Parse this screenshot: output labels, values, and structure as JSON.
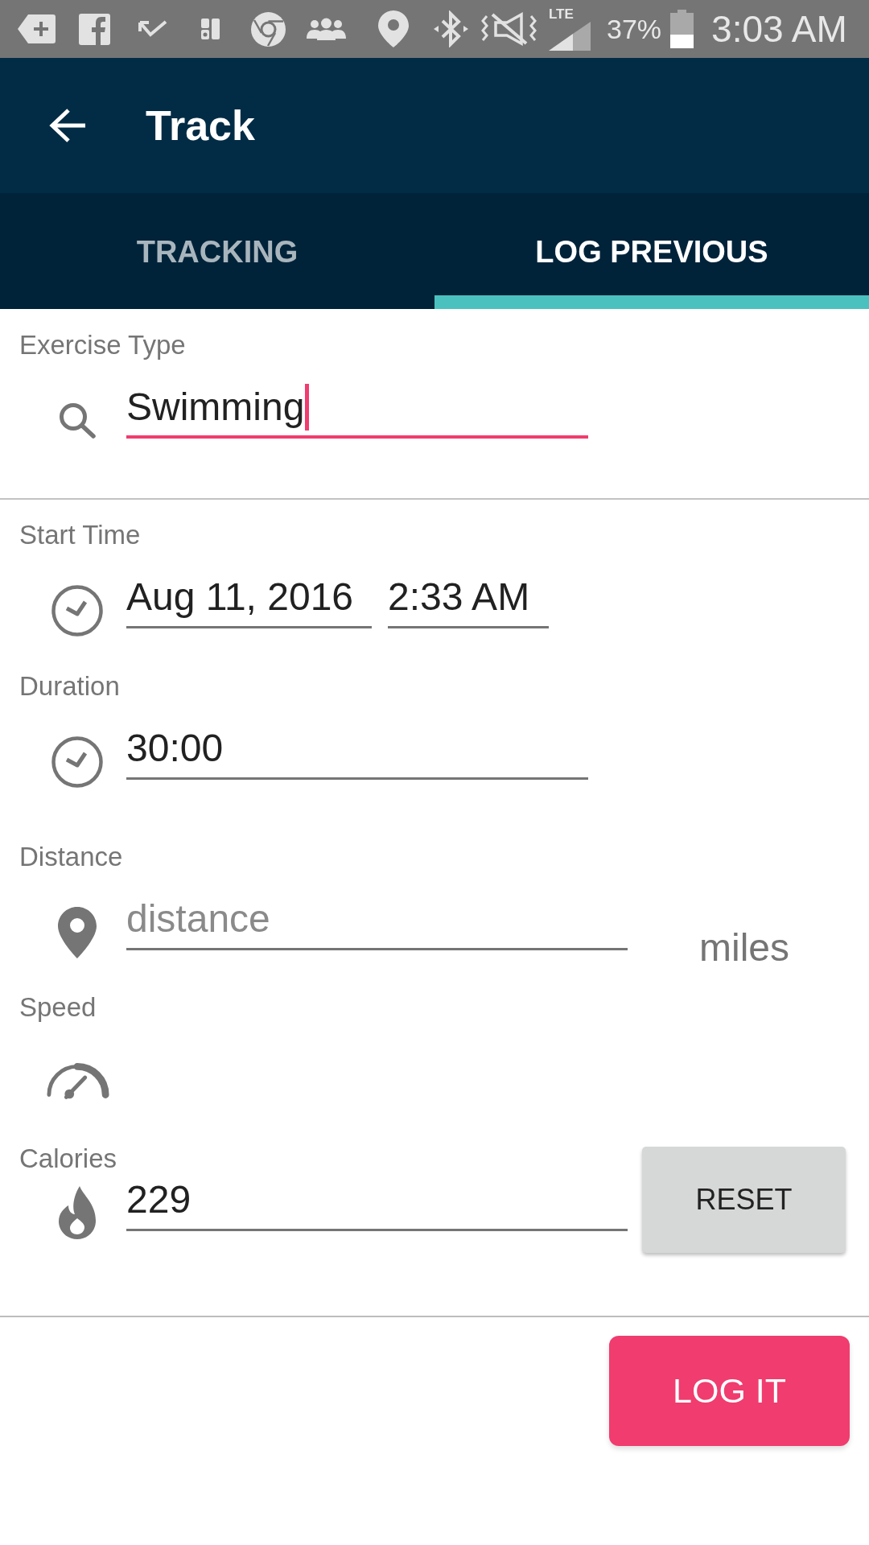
{
  "status_bar": {
    "network_type": "LTE",
    "battery": "37%",
    "time": "3:03 AM"
  },
  "app_bar": {
    "title": "Track"
  },
  "tabs": [
    {
      "label": "TRACKING",
      "selected": false
    },
    {
      "label": "LOG PREVIOUS",
      "selected": true
    }
  ],
  "exercise_type": {
    "label": "Exercise Type",
    "value": "Swimming",
    "focused": true
  },
  "fields": [
    {
      "kind": "datetime",
      "label": "Start Time",
      "date": "Aug 11, 2016",
      "time": "2:33 AM"
    },
    {
      "kind": "text",
      "label": "Duration",
      "value": "30:00"
    },
    {
      "kind": "unit",
      "label": "Distance",
      "placeholder": "distance",
      "unit": "miles"
    },
    {
      "kind": "display",
      "label": "Speed"
    },
    {
      "kind": "action",
      "label": "Calories",
      "value": "229",
      "button": "RESET"
    }
  ],
  "submit_button": "LOG IT"
}
